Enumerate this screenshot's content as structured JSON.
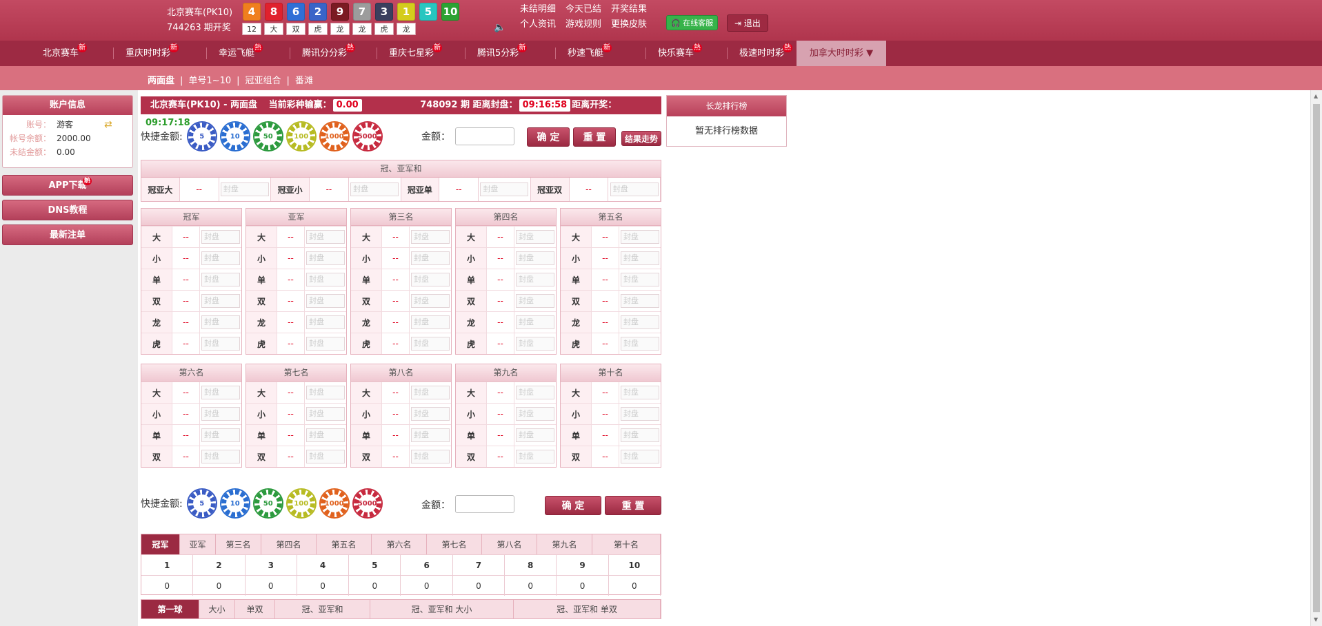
{
  "header": {
    "game_name": "北京赛车(PK10)",
    "issue_open": "744263 期开奖",
    "balls": [
      {
        "num": "4",
        "color": "#f07f1e",
        "res": "12"
      },
      {
        "num": "8",
        "color": "#e0212d",
        "res": "大"
      },
      {
        "num": "6",
        "color": "#2f6fd6",
        "res": "双"
      },
      {
        "num": "2",
        "color": "#3a64c8",
        "res": "虎"
      },
      {
        "num": "9",
        "color": "#7b1b22",
        "res": "龙"
      },
      {
        "num": "7",
        "color": "#9c9c9c",
        "res": "龙"
      },
      {
        "num": "3",
        "color": "#3a3f5e",
        "res": "虎"
      },
      {
        "num": "1",
        "color": "#d4cc1d",
        "res": "龙"
      },
      {
        "num": "5",
        "color": "#28c6c0",
        "res": ""
      },
      {
        "num": "10",
        "color": "#2da233",
        "res": ""
      }
    ],
    "links": [
      "未结明细",
      "今天已结",
      "开奖结果",
      "个人资讯",
      "游戏规则",
      "更换皮肤"
    ],
    "service": "在线客服",
    "logout": "退出"
  },
  "nav": {
    "items": [
      {
        "label": "北京赛车",
        "tag": "新"
      },
      {
        "label": "重庆时时彩",
        "tag": "新"
      },
      {
        "label": "幸运飞艇",
        "tag": "熱"
      },
      {
        "label": "腾讯分分彩",
        "tag": "熱"
      },
      {
        "label": "重庆七星彩",
        "tag": "新"
      },
      {
        "label": "腾讯5分彩",
        "tag": "新"
      },
      {
        "label": "秒速飞艇",
        "tag": "新"
      },
      {
        "label": "快乐赛车",
        "tag": "熱"
      },
      {
        "label": "极速时时彩",
        "tag": "熱"
      }
    ],
    "active": "加拿大时时彩",
    "active_arrow": "▼"
  },
  "subnav": [
    "两面盘",
    "单号1~10",
    "冠亚组合",
    "番滩"
  ],
  "account": {
    "title": "账户信息",
    "rows": [
      {
        "k": "账号：",
        "v": "游客"
      },
      {
        "k": "帐号余额：",
        "v": "2000.00"
      },
      {
        "k": "未结金额：",
        "v": "0.00"
      }
    ]
  },
  "left_buttons": [
    {
      "label": "APP下载",
      "tag": "熱"
    },
    {
      "label": "DNS教程",
      "tag": ""
    },
    {
      "label": "最新注单",
      "tag": ""
    }
  ],
  "infobar": {
    "game": "北京赛车(PK10)",
    "sep": " - ",
    "mode": "两面盘",
    "profit_label": "当前彩种输赢：",
    "profit": "0.00",
    "issue": "748092 期",
    "close_label": "距离封盘：",
    "close_time": "09:16:58",
    "open_label": "距离开奖：",
    "open_time": "09:17:18"
  },
  "quick": {
    "label": "快捷金额:",
    "chips": [
      {
        "v": "5",
        "color": "#3b5cc4"
      },
      {
        "v": "10",
        "color": "#2a6ed1"
      },
      {
        "v": "50",
        "color": "#2c9a3e"
      },
      {
        "v": "100",
        "color": "#b7bb23"
      },
      {
        "v": "1000",
        "color": "#e0611d"
      },
      {
        "v": "5000",
        "color": "#c72a3f"
      }
    ],
    "amount_label": "金额：",
    "confirm": "确 定",
    "reset": "重 置",
    "trend": "结果走势"
  },
  "sum_group": {
    "title": "冠、亚军和",
    "items": [
      {
        "label": "冠亚大",
        "odds": "--",
        "ph": "封盘"
      },
      {
        "label": "冠亚小",
        "odds": "--",
        "ph": "封盘"
      },
      {
        "label": "冠亚单",
        "odds": "--",
        "ph": "封盘"
      },
      {
        "label": "冠亚双",
        "odds": "--",
        "ph": "封盘"
      }
    ]
  },
  "groups_top": {
    "names": [
      "冠军",
      "亚军",
      "第三名",
      "第四名",
      "第五名"
    ],
    "rows": [
      "大",
      "小",
      "单",
      "双",
      "龙",
      "虎"
    ],
    "odds": "--",
    "ph": "封盘"
  },
  "groups_bottom": {
    "names": [
      "第六名",
      "第七名",
      "第八名",
      "第九名",
      "第十名"
    ],
    "rows": [
      "大",
      "小",
      "单",
      "双"
    ],
    "odds": "--",
    "ph": "封盘"
  },
  "ranking": {
    "title": "长龙排行榜",
    "empty": "暂无排行榜数据"
  },
  "stats": {
    "tabs": [
      "冠军",
      "亚军",
      "第三名",
      "第四名",
      "第五名",
      "第六名",
      "第七名",
      "第八名",
      "第九名",
      "第十名"
    ],
    "nums": [
      "1",
      "2",
      "3",
      "4",
      "5",
      "6",
      "7",
      "8",
      "9",
      "10"
    ],
    "counts": [
      "0",
      "0",
      "0",
      "0",
      "0",
      "0",
      "0",
      "0",
      "0",
      "0"
    ]
  },
  "bottom_tabs": [
    "第一球",
    "大小",
    "单双",
    "冠、亚军和",
    "冠、亚军和 大小",
    "冠、亚军和 单双"
  ]
}
